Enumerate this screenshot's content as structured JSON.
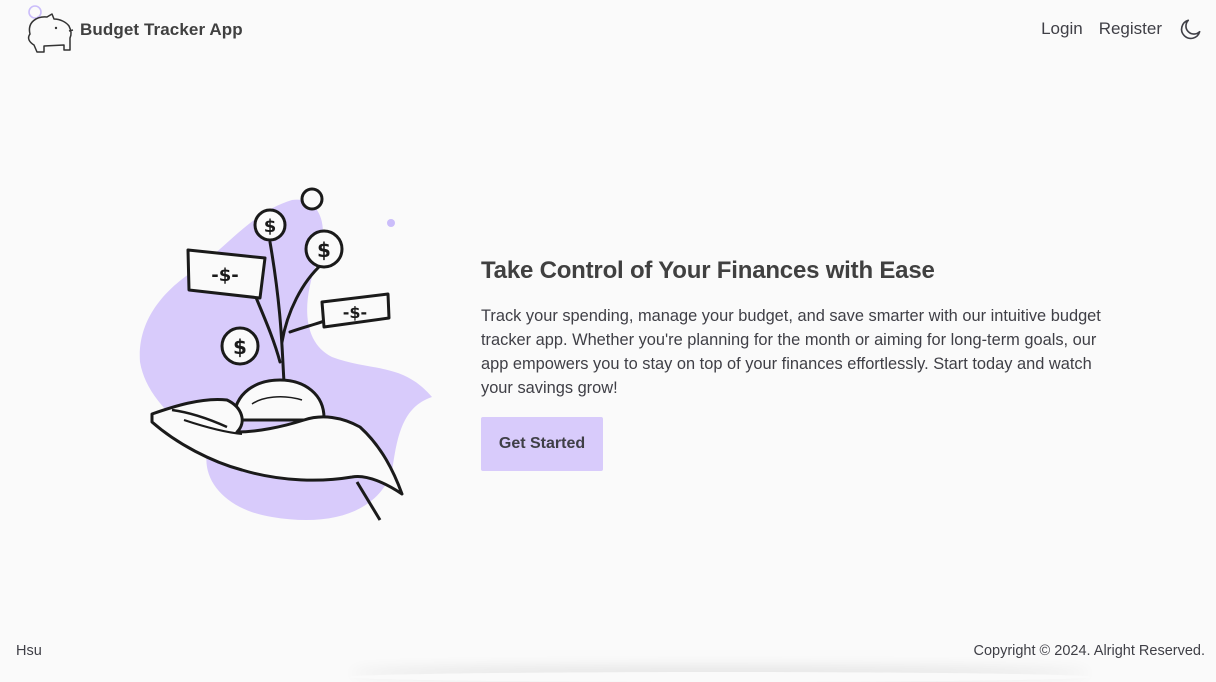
{
  "navbar": {
    "brand_title": "Budget Tracker App",
    "brand_logo_icon": "piggy-bank-icon",
    "links": {
      "login": "Login",
      "register": "Register"
    },
    "theme_toggle_icon": "moon-icon"
  },
  "hero": {
    "illustration_icon": "hand-holding-money-plant-icon",
    "title": "Take Control of Your Finances with Ease",
    "description": "Track your spending, manage your budget, and save smarter with our intuitive budget tracker app. Whether you're planning for the month or aiming for long-term goals, our app empowers you to stay on top of your finances effortlessly. Start today and watch your savings grow!",
    "cta_label": "Get Started"
  },
  "footer": {
    "left_text": "Hsu",
    "right_text": "Copyright © 2024. Alright Reserved."
  },
  "colors": {
    "accent": "#d8cbfb",
    "accent_dark": "#cbbdfa",
    "background": "#fafafa",
    "text": "#3f3f46"
  }
}
